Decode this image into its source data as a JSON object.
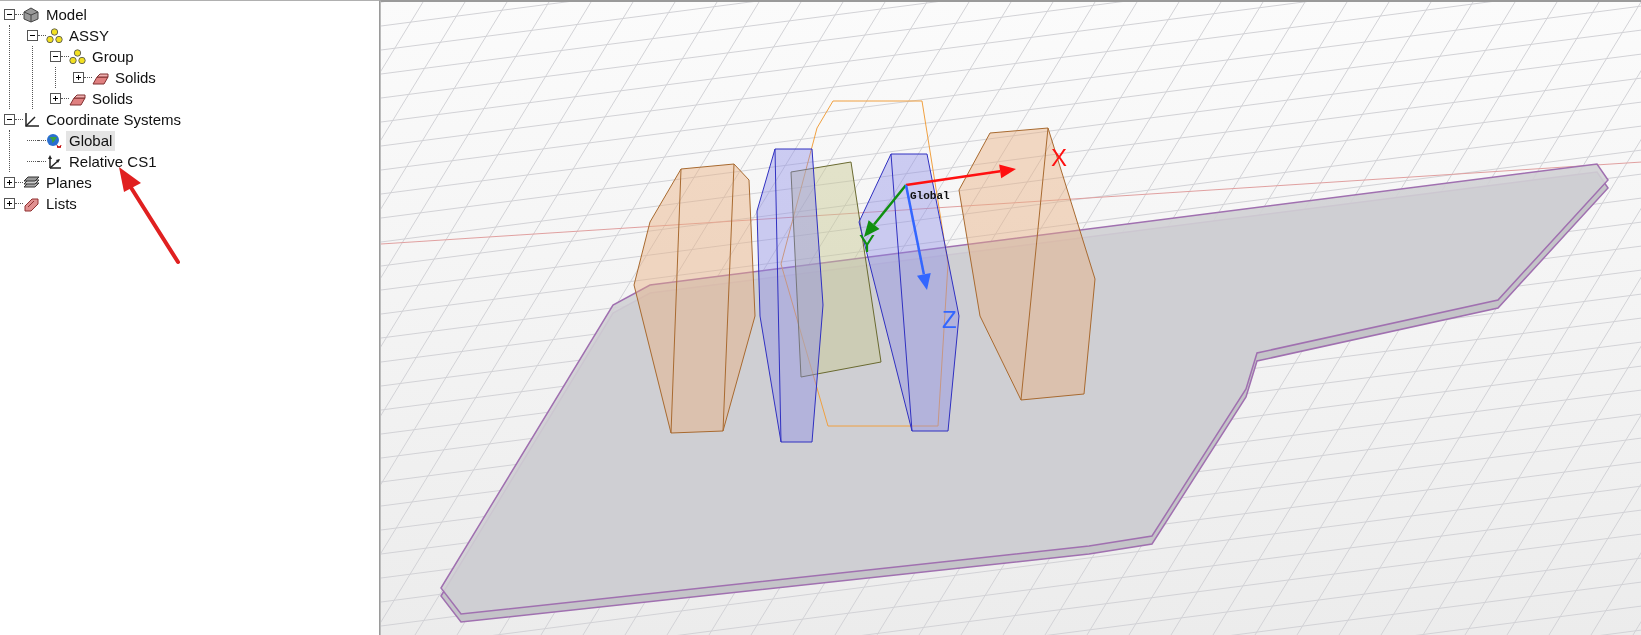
{
  "tree": [
    {
      "label": "Model",
      "kind": "model",
      "expanded": true,
      "selected": false,
      "children": [
        {
          "label": "ASSY",
          "kind": "assembly",
          "expanded": true,
          "selected": false,
          "children": [
            {
              "label": "Group",
              "kind": "assembly",
              "expanded": true,
              "selected": false,
              "children": [
                {
                  "label": "Solids",
                  "kind": "solids",
                  "expanded": false,
                  "selected": false
                }
              ]
            },
            {
              "label": "Solids",
              "kind": "solids",
              "expanded": false,
              "selected": false
            }
          ]
        }
      ]
    },
    {
      "label": "Coordinate Systems",
      "kind": "coordinate-systems",
      "expanded": true,
      "selected": false,
      "children": [
        {
          "label": "Global",
          "kind": "global-cs",
          "selected": true
        },
        {
          "label": "Relative CS1",
          "kind": "relative-cs",
          "selected": false
        }
      ]
    },
    {
      "label": "Planes",
      "kind": "planes",
      "expanded": false,
      "selected": false
    },
    {
      "label": "Lists",
      "kind": "lists",
      "expanded": false,
      "selected": false
    }
  ],
  "viewport": {
    "cs_label": "Global",
    "axes": [
      {
        "label": "X",
        "color": "#ff1010"
      },
      {
        "label": "Y",
        "color": "#109010"
      },
      {
        "label": "Z",
        "color": "#3366ff"
      }
    ]
  }
}
